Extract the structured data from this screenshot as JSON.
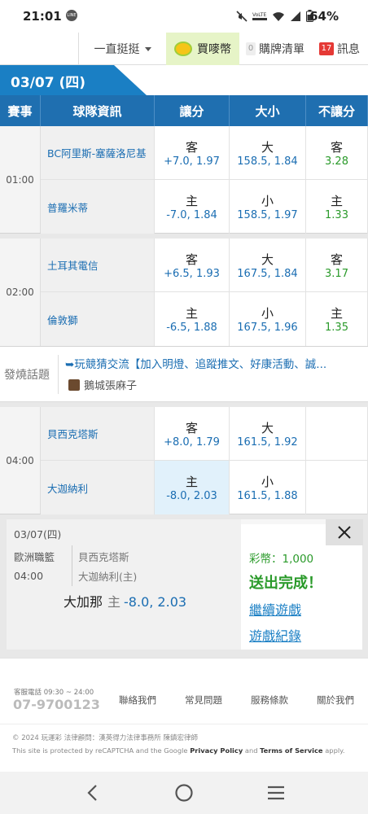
{
  "status_bar": {
    "time": "21:01",
    "chat_icon_text": "LINE",
    "battery": "64%",
    "network_label": "VoLTE"
  },
  "topnav": {
    "sort_label": "一直挺挺",
    "buy_label": "買嘜幣",
    "cart_count": "0",
    "cart_label": "購牌清單",
    "msg_count": "17",
    "msg_label": "訊息"
  },
  "date_header": "03/07 (四)",
  "table_headers": {
    "event": "賽事",
    "team": "球隊資訊",
    "spread": "讓分",
    "total": "大小",
    "moneyline": "不讓分"
  },
  "games": [
    {
      "time": "01:00",
      "rows": [
        {
          "team": "BC阿里斯-塞薩洛尼基",
          "spread_side": "客",
          "spread": "+7.0, 1.97",
          "total_side": "大",
          "total": "158.5, 1.84",
          "ml_side": "客",
          "ml": "3.28"
        },
        {
          "team": "普羅米蒂",
          "spread_side": "主",
          "spread": "-7.0, 1.84",
          "total_side": "小",
          "total": "158.5, 1.97",
          "ml_side": "主",
          "ml": "1.33"
        }
      ]
    },
    {
      "time": "02:00",
      "rows": [
        {
          "team": "土耳其電信",
          "spread_side": "客",
          "spread": "+6.5, 1.93",
          "total_side": "大",
          "total": "167.5, 1.84",
          "ml_side": "客",
          "ml": "3.17"
        },
        {
          "team": "倫敦獅",
          "spread_side": "主",
          "spread": "-6.5, 1.88",
          "total_side": "小",
          "total": "167.5, 1.96",
          "ml_side": "主",
          "ml": "1.35"
        }
      ]
    },
    {
      "time": "04:00",
      "rows": [
        {
          "team": "貝西克塔斯",
          "spread_side": "客",
          "spread": "+8.0, 1.79",
          "total_side": "大",
          "total": "161.5, 1.92",
          "ml_side": "",
          "ml": ""
        },
        {
          "team": "大迦納利",
          "spread_side": "主",
          "spread": "-8.0, 2.03",
          "total_side": "小",
          "total": "161.5, 1.88",
          "ml_side": "",
          "ml": ""
        }
      ]
    }
  ],
  "hot_topic": {
    "label": "發燒話題",
    "title": "➥玩競猜交流【加入明燈、追蹤推文、好康活動、誠...",
    "user": "鵝城張麻子"
  },
  "confirm_panel": {
    "date": "03/07(四)",
    "league": "歐洲職籃",
    "time": "04:00",
    "team_away": "貝西克塔斯",
    "team_home": "大迦納利(主)",
    "pick_team": "大加那",
    "pick_side": "主",
    "pick_line": "-8.0, 2.03",
    "coins": "彩幣：1,000",
    "done": "送出完成！",
    "continue_link": "繼續遊戲",
    "record_link": "遊戲紀錄"
  },
  "footer": {
    "hotline_label": "客服電話 09:30 ~ 24:00",
    "phone": "07-9700123",
    "links": [
      "聯絡我們",
      "常見問題",
      "服務條款",
      "關於我們"
    ],
    "copyright": "© 2024 玩運彩  法律顧問：漢英得力法律事務所 陳鎮宏律師",
    "recaptcha_prefix": "This site is protected by reCAPTCHA and the Google ",
    "privacy": "Privacy Policy",
    "and": " and ",
    "terms": "Terms of Service",
    "apply": " apply."
  },
  "colors": {
    "brand_blue": "#1f6fb0",
    "link_blue": "#1a6db2",
    "green": "#2a9a2a",
    "selected_bg": "#e1f1fb"
  }
}
